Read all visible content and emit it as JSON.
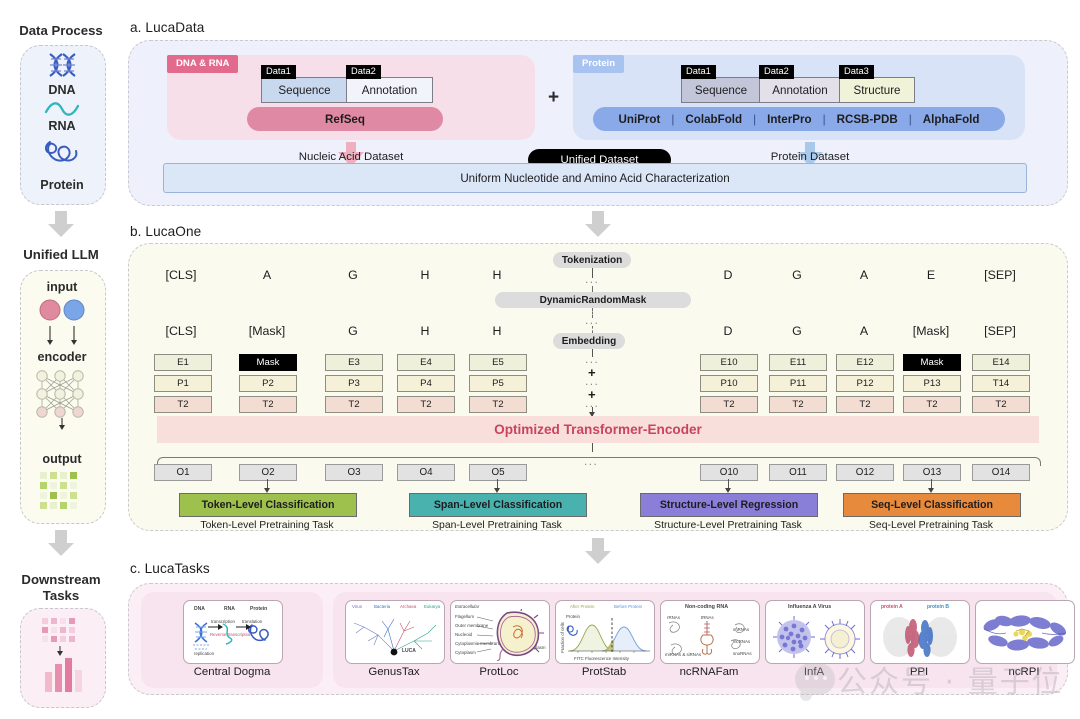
{
  "left_column": {
    "sections": [
      {
        "title": "Data Process",
        "items": [
          {
            "icon": "dna-helix-icon",
            "label": "DNA"
          },
          {
            "icon": "rna-strand-icon",
            "label": "RNA"
          },
          {
            "icon": "protein-fold-icon",
            "label": "Protein"
          }
        ]
      },
      {
        "title": "Unified LLM",
        "items": [
          {
            "icon": "input-circles-icon",
            "label": "input"
          },
          {
            "icon": "neural-network-icon",
            "label": "encoder"
          },
          {
            "icon": "output-grid-icon",
            "label": "output"
          }
        ]
      },
      {
        "title": "Downstream\nTasks",
        "title_line1": "Downstream",
        "title_line2": "Tasks",
        "items": [
          {
            "icon": "heatmap-grid-icon",
            "label": ""
          },
          {
            "icon": "bar-chart-icon",
            "label": ""
          }
        ]
      }
    ]
  },
  "panel_a": {
    "title": "a. LucaData",
    "dna_card": {
      "tag": "DNA & RNA",
      "data_boxes": [
        {
          "label": "Data1",
          "text": "Sequence"
        },
        {
          "label": "Data2",
          "text": "Annotation"
        }
      ],
      "source_pill": "RefSeq"
    },
    "plus": "+",
    "protein_card": {
      "tag": "Protein",
      "data_boxes": [
        {
          "label": "Data1",
          "text": "Sequence"
        },
        {
          "label": "Data2",
          "text": "Annotation"
        },
        {
          "label": "Data3",
          "text": "Structure"
        }
      ],
      "sources": [
        "UniProt",
        "ColabFold",
        "InterPro",
        "RCSB-PDB",
        "AlphaFold"
      ],
      "source_separator": "|"
    },
    "nucleic_dataset_label": "Nucleic Acid Dataset",
    "unified_dataset_label": "Unified Dataset",
    "protein_dataset_label": "Protein Dataset",
    "uniform_bar": "Uniform Nucleotide and Amino Acid  Characterization"
  },
  "panel_b": {
    "title": "b. LucaOne",
    "chips": [
      "Tokenization",
      "DynamicRandomMask",
      "Embedding"
    ],
    "ellipsis": "...",
    "plus": "+",
    "left_tokens_row1": [
      "[CLS]",
      "A",
      "G",
      "H",
      "H"
    ],
    "right_tokens_row1": [
      "D",
      "G",
      "A",
      "E",
      "[SEP]"
    ],
    "left_tokens_row2": [
      "[CLS]",
      "[Mask]",
      "G",
      "H",
      "H"
    ],
    "right_tokens_row2": [
      "D",
      "G",
      "A",
      "[Mask]",
      "[SEP]"
    ],
    "left_embeddings": {
      "e": [
        "E1",
        "Mask",
        "E3",
        "E4",
        "E5"
      ],
      "p": [
        "P1",
        "P2",
        "P3",
        "P4",
        "P5"
      ],
      "t": [
        "T2",
        "T2",
        "T2",
        "T2",
        "T2"
      ],
      "e_masked_index": 1
    },
    "right_embeddings": {
      "e": [
        "E10",
        "E11",
        "E12",
        "Mask",
        "E14"
      ],
      "p": [
        "P10",
        "P11",
        "P12",
        "P13",
        "T14"
      ],
      "t": [
        "T2",
        "T2",
        "T2",
        "T2",
        "T2"
      ],
      "e_masked_index": 3
    },
    "encoder_bar": "Optimized Transformer-Encoder",
    "left_outputs": [
      "O1",
      "O2",
      "O3",
      "O4",
      "O5"
    ],
    "right_outputs": [
      "O10",
      "O11",
      "O12",
      "O13",
      "O14"
    ],
    "tasks": [
      {
        "box": "Token-Level Classification",
        "caption": "Token-Level Pretraining Task",
        "color": "#9ec04d"
      },
      {
        "box": "Span-Level Classification",
        "caption": "Span-Level Pretraining Task",
        "color": "#49b2ae"
      },
      {
        "box": "Structure-Level Regression",
        "caption": "Structure-Level Pretraining Task",
        "color": "#8a7fd8"
      },
      {
        "box": "Seq-Level Classification",
        "caption": "Seq-Level Pretraining Task",
        "color": "#e88a3c"
      }
    ]
  },
  "panel_c": {
    "title": "c. LucaTasks",
    "group1": [
      {
        "name": "Central Dogma",
        "thumb_labels": [
          "DNA",
          "RNA",
          "Protein",
          "transcription",
          "translation",
          "Reverse transcription",
          "replication"
        ]
      }
    ],
    "group2": [
      {
        "name": "GenusTax",
        "thumb_labels": [
          "Virus",
          "Bacteria",
          "Archaea",
          "Eukarya",
          "LUCA"
        ]
      },
      {
        "name": "ProtLoc",
        "thumb_labels": [
          "Extracellular",
          "Flagellum",
          "Outer membrane",
          "Nucleoid",
          "Cytoplasmic membrane",
          "Cytoplasm",
          "Periplasm",
          "Protein"
        ]
      },
      {
        "name": "ProtStab",
        "thumb_labels": [
          "After Protein",
          "Before Protein",
          "Protein",
          "Fraction of cells",
          "FITC Fluorescence Intensity"
        ]
      },
      {
        "name": "ncRNAFam",
        "thumb_labels": [
          "Non-coding RNA",
          "rRNAs",
          "tRNAs",
          "snRNAs",
          "lncRNAs",
          "miRNAs & siRNAs",
          "snoRNAs"
        ]
      },
      {
        "name": "InfA",
        "thumb_labels": [
          "Influenza A Virus"
        ]
      },
      {
        "name": "PPI",
        "thumb_labels": [
          "protein A",
          "protein B"
        ]
      },
      {
        "name": "ncRPI",
        "thumb_labels": []
      }
    ]
  },
  "watermark": {
    "text": "公众号 · 量子位",
    "icon": "wechat-icon"
  },
  "colors": {
    "panel_a_bg": "#eef1fb",
    "panel_b_bg": "#fafaee",
    "panel_c_bg": "#fbeef4",
    "dna_card": "#f7dfe9",
    "protein_card": "#d9e3f8",
    "dna_tag": "#e26a8d",
    "protein_tag": "#a8c3ef",
    "refseq_pill": "#e089a5",
    "protein_pill": "#8aa9e8",
    "encoder_text": "#c9445e",
    "encoder_bar": "#f8dfdc"
  }
}
